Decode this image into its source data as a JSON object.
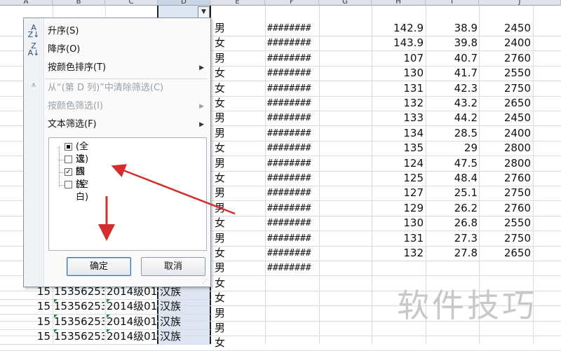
{
  "headers": [
    "A",
    "B",
    "C",
    "D",
    "E",
    "F",
    "G",
    "H",
    "I",
    "J"
  ],
  "rows": [
    {
      "e": "男",
      "f": "########",
      "h": "142.9",
      "i": "38.9",
      "j": "2450"
    },
    {
      "e": "女",
      "f": "########",
      "h": "143.9",
      "i": "39.8",
      "j": "2400"
    },
    {
      "e": "男",
      "f": "########",
      "h": "107",
      "i": "40.7",
      "j": "2760"
    },
    {
      "e": "女",
      "f": "########",
      "h": "130",
      "i": "41.7",
      "j": "2550"
    },
    {
      "e": "女",
      "f": "########",
      "h": "131",
      "i": "42.3",
      "j": "2750"
    },
    {
      "e": "女",
      "f": "########",
      "h": "132",
      "i": "43.2",
      "j": "2650"
    },
    {
      "e": "男",
      "f": "########",
      "h": "133",
      "i": "44.2",
      "j": "2450"
    },
    {
      "e": "男",
      "f": "########",
      "h": "134",
      "i": "28.5",
      "j": "2400"
    },
    {
      "e": "女",
      "f": "########",
      "h": "135",
      "i": "29",
      "j": "2800"
    },
    {
      "e": "男",
      "f": "########",
      "h": "124",
      "i": "47.5",
      "j": "2800"
    },
    {
      "e": "女",
      "f": "########",
      "h": "125",
      "i": "48.4",
      "j": "2760"
    },
    {
      "e": "男",
      "f": "########",
      "h": "127",
      "i": "25.1",
      "j": "2750"
    },
    {
      "e": "男",
      "f": "########",
      "h": "129",
      "i": "26.2",
      "j": "2760"
    },
    {
      "e": "女",
      "f": "########",
      "h": "130",
      "i": "26.8",
      "j": "2550"
    },
    {
      "e": "男",
      "f": "########",
      "h": "131",
      "i": "27.3",
      "j": "2750"
    },
    {
      "e": "女",
      "f": "########",
      "h": "132",
      "i": "27.8",
      "j": "2650"
    },
    {
      "e": "男",
      "f": "########",
      "h": "",
      "i": "",
      "j": ""
    },
    {
      "e": "女",
      "f": "",
      "h": "",
      "i": "",
      "j": ""
    },
    {
      "e": "女",
      "f": "",
      "h": "",
      "i": "",
      "j": ""
    },
    {
      "e": "男",
      "f": "",
      "h": "",
      "i": "",
      "j": ""
    },
    {
      "e": "男",
      "f": "",
      "h": "",
      "i": "",
      "j": ""
    },
    {
      "e": "女",
      "f": "",
      "h": "",
      "i": "",
      "j": ""
    }
  ],
  "bottom_rows": [
    {
      "a": "15",
      "b": "15356253",
      "c": "2014级01",
      "d": "汉族"
    },
    {
      "a": "15",
      "b": "15356253",
      "c": "2014级01",
      "d": "汉族"
    },
    {
      "a": "15",
      "b": "15356253",
      "c": "2014级01",
      "d": "汉族"
    },
    {
      "a": "15",
      "b": "15356253",
      "c": "2014级01",
      "d": "汉族"
    }
  ],
  "menu": {
    "sort_asc": "升序(S)",
    "sort_desc": "降序(O)",
    "sort_color": "按颜色排序(T)",
    "clear_filter": "从“(第 D 列)”中清除筛选(C)",
    "filter_color": "按颜色筛选(I)",
    "text_filter": "文本筛选(F)",
    "values": [
      {
        "label": "(全选)",
        "state": "partial"
      },
      {
        "label": "汉族",
        "state": "unchecked"
      },
      {
        "label": "回族",
        "state": "checked"
      },
      {
        "label": "(空白)",
        "state": "unchecked"
      }
    ],
    "ok": "确定",
    "cancel": "取消"
  },
  "icons": {
    "sort_asc": "sort-ascending-icon",
    "sort_desc": "sort-descending-icon",
    "clear_filter": "clear-filter-icon",
    "dropdown": "dropdown-arrow-icon",
    "submenu": "submenu-arrow-icon"
  },
  "colors": {
    "annotation_arrow": "#d42d2d",
    "selection": "#dde6f2",
    "triangle": "#1a8d3a"
  },
  "watermark": "软件技巧"
}
